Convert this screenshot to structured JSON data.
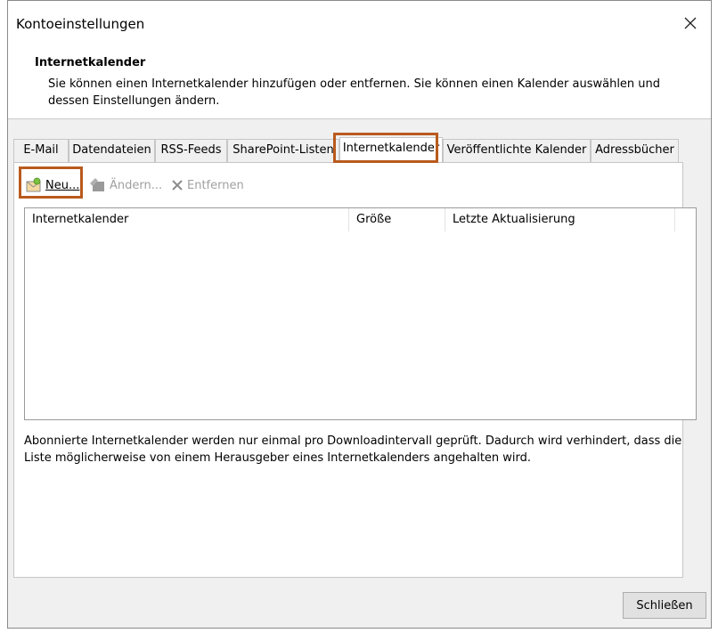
{
  "dialog": {
    "title": "Kontoeinstellungen",
    "header_title": "Internetkalender",
    "header_desc": "Sie können einen Internetkalender hinzufügen oder entfernen. Sie können einen Kalender auswählen und dessen Einstellungen ändern."
  },
  "tabs": [
    {
      "label": "E-Mail"
    },
    {
      "label": "Datendateien"
    },
    {
      "label": "RSS-Feeds"
    },
    {
      "label": "SharePoint-Listen"
    },
    {
      "label": "Internetkalender"
    },
    {
      "label": "Veröffentlichte Kalender"
    },
    {
      "label": "Adressbücher"
    }
  ],
  "active_tab": "Internetkalender",
  "toolbar": {
    "new_label": "Neu...",
    "change_label": "Ändern...",
    "remove_label": "Entfernen"
  },
  "list": {
    "columns": [
      "Internetkalender",
      "Größe",
      "Letzte Aktualisierung"
    ],
    "rows": []
  },
  "info_text": "Abonnierte Internetkalender werden nur einmal pro Downloadintervall geprüft. Dadurch wird verhindert, dass die Liste möglicherweise von einem Herausgeber eines Internetkalenders angehalten wird.",
  "close_button": "Schließen",
  "colors": {
    "highlight": "#b95a1d",
    "disabled_text": "#a0a0a0"
  },
  "icons": {
    "new": "new-calendar-icon",
    "change": "change-icon",
    "remove": "remove-x-icon",
    "close": "close-icon"
  }
}
